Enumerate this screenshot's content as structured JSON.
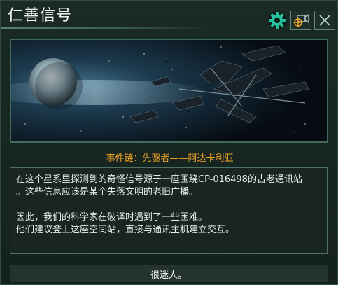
{
  "window": {
    "title": "仁善信号"
  },
  "toolbar": {
    "settings_icon": "gear-icon",
    "camera_icon": "camera-target-icon",
    "close_icon": "close-icon",
    "accent_color": "#25c0a0",
    "orange_color": "#f0a424"
  },
  "event": {
    "chain_label": "事件链：先驱者——阿达卡利亚",
    "description": [
      "在这个星系里探测到的奇怪信号源于一座围绕CP-016498的古老通讯站",
      "。这些信息应该是某个失落文明的老旧广播。",
      "",
      "因此，我们的科学家在破译时遇到了一些困难。",
      "他们建议登上这座空间站，直接与通讯主机建立交互。"
    ]
  },
  "options": [
    {
      "label": "很迷人。"
    }
  ]
}
